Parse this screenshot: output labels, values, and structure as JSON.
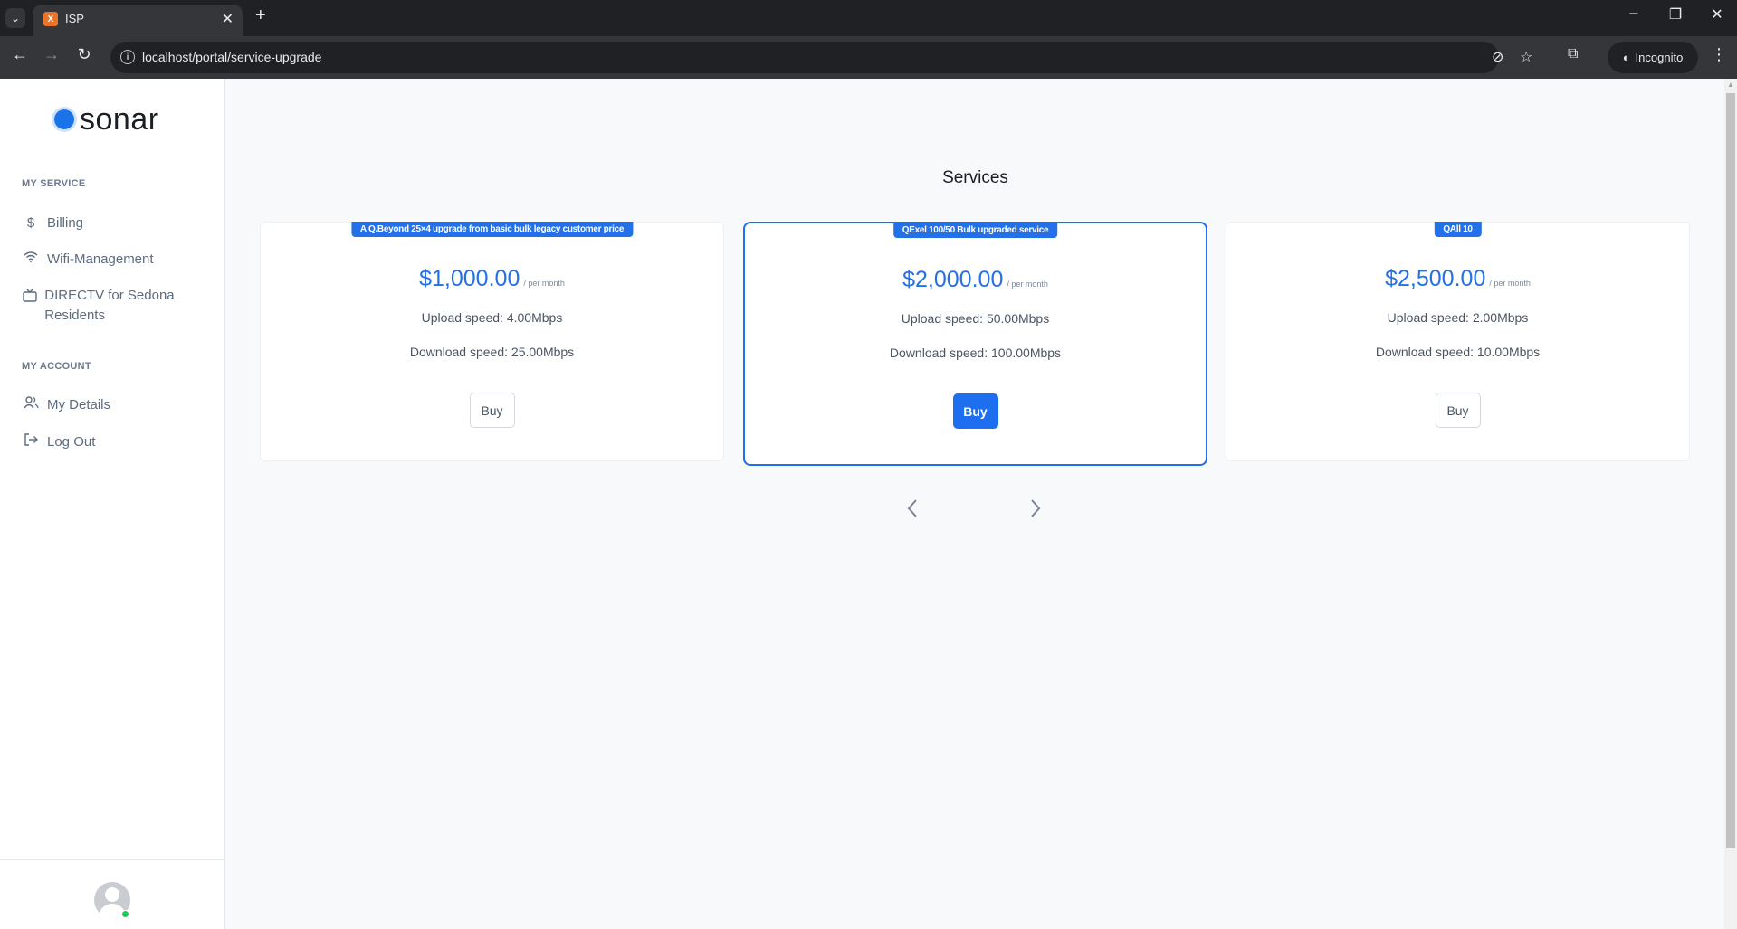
{
  "browser": {
    "tab_favicon": "X",
    "tab_title": "ISP",
    "url": "localhost/portal/service-upgrade",
    "incognito_label": "Incognito"
  },
  "sidebar": {
    "logo_text": "sonar",
    "sections": [
      {
        "title": "MY SERVICE",
        "items": [
          {
            "label": "Billing",
            "icon": "dollar-icon"
          },
          {
            "label": "Wifi-Management",
            "icon": "wifi-icon"
          },
          {
            "label": "DIRECTV for Sedona Residents",
            "icon": "tv-icon"
          }
        ]
      },
      {
        "title": "MY ACCOUNT",
        "items": [
          {
            "label": "My Details",
            "icon": "users-icon"
          },
          {
            "label": "Log Out",
            "icon": "logout-icon"
          }
        ]
      }
    ]
  },
  "main": {
    "title": "Services",
    "cards": [
      {
        "badge": "A Q.Beyond 25×4 upgrade from basic bulk legacy customer price",
        "price": "$1,000.00",
        "per": "/ per month",
        "upload": "Upload speed: 4.00Mbps",
        "download": "Download speed: 25.00Mbps",
        "button": "Buy",
        "featured": false
      },
      {
        "badge": "QExel 100/50 Bulk upgraded service",
        "price": "$2,000.00",
        "per": "/ per month",
        "upload": "Upload speed: 50.00Mbps",
        "download": "Download speed: 100.00Mbps",
        "button": "Buy",
        "featured": true
      },
      {
        "badge": "QAll 10",
        "price": "$2,500.00",
        "per": "/ per month",
        "upload": "Upload speed: 2.00Mbps",
        "download": "Download speed: 10.00Mbps",
        "button": "Buy",
        "featured": false
      }
    ],
    "pager": {
      "prev_icon": "chevron-left-icon",
      "next_icon": "chevron-right-icon"
    }
  },
  "colors": {
    "accent": "#1e6ff0",
    "online": "#22c55e"
  }
}
